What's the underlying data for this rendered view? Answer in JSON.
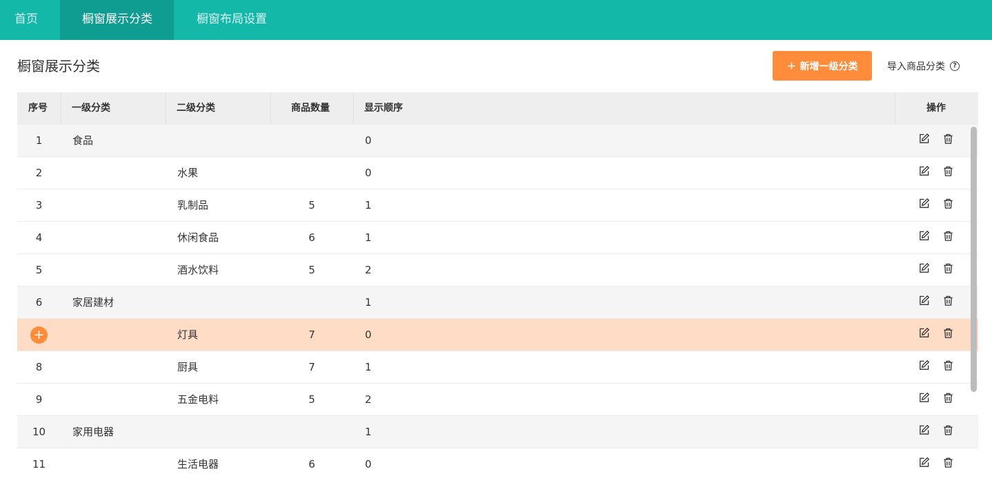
{
  "nav": {
    "tabs": [
      {
        "label": "首页"
      },
      {
        "label": "橱窗展示分类"
      },
      {
        "label": "橱窗布局设置"
      }
    ]
  },
  "page": {
    "title": "橱窗展示分类",
    "add_button": "新增一级分类",
    "import_link": "导入商品分类"
  },
  "table": {
    "headers": {
      "index": "序号",
      "level1": "一级分类",
      "level2": "二级分类",
      "count": "商品数量",
      "order": "显示顺序",
      "actions": "操作"
    },
    "rows": [
      {
        "index": "1",
        "level1": "食品",
        "level2": "",
        "count": "",
        "order": "0"
      },
      {
        "index": "2",
        "level1": "",
        "level2": "水果",
        "count": "",
        "order": "0"
      },
      {
        "index": "3",
        "level1": "",
        "level2": "乳制品",
        "count": "5",
        "order": "1"
      },
      {
        "index": "4",
        "level1": "",
        "level2": "休闲食品",
        "count": "6",
        "order": "1"
      },
      {
        "index": "5",
        "level1": "",
        "level2": "酒水饮料",
        "count": "5",
        "order": "2"
      },
      {
        "index": "6",
        "level1": "家居建材",
        "level2": "",
        "count": "",
        "order": "1"
      },
      {
        "index": "",
        "level1": "",
        "level2": "灯具",
        "count": "7",
        "order": "0"
      },
      {
        "index": "8",
        "level1": "",
        "level2": "厨具",
        "count": "7",
        "order": "1"
      },
      {
        "index": "9",
        "level1": "",
        "level2": "五金电料",
        "count": "5",
        "order": "2"
      },
      {
        "index": "10",
        "level1": "家用电器",
        "level2": "",
        "count": "",
        "order": "1"
      },
      {
        "index": "11",
        "level1": "",
        "level2": "生活电器",
        "count": "6",
        "order": "0"
      }
    ]
  },
  "colors": {
    "nav_bg": "#13b8a9",
    "nav_active_bg": "#109d91",
    "accent_orange": "#ff8c3b",
    "highlight_row": "#ffdcc6"
  },
  "icons": {
    "edit": "edit-icon",
    "delete": "trash-icon",
    "help": "help-circle-icon",
    "expand": "plus-circle-icon"
  }
}
